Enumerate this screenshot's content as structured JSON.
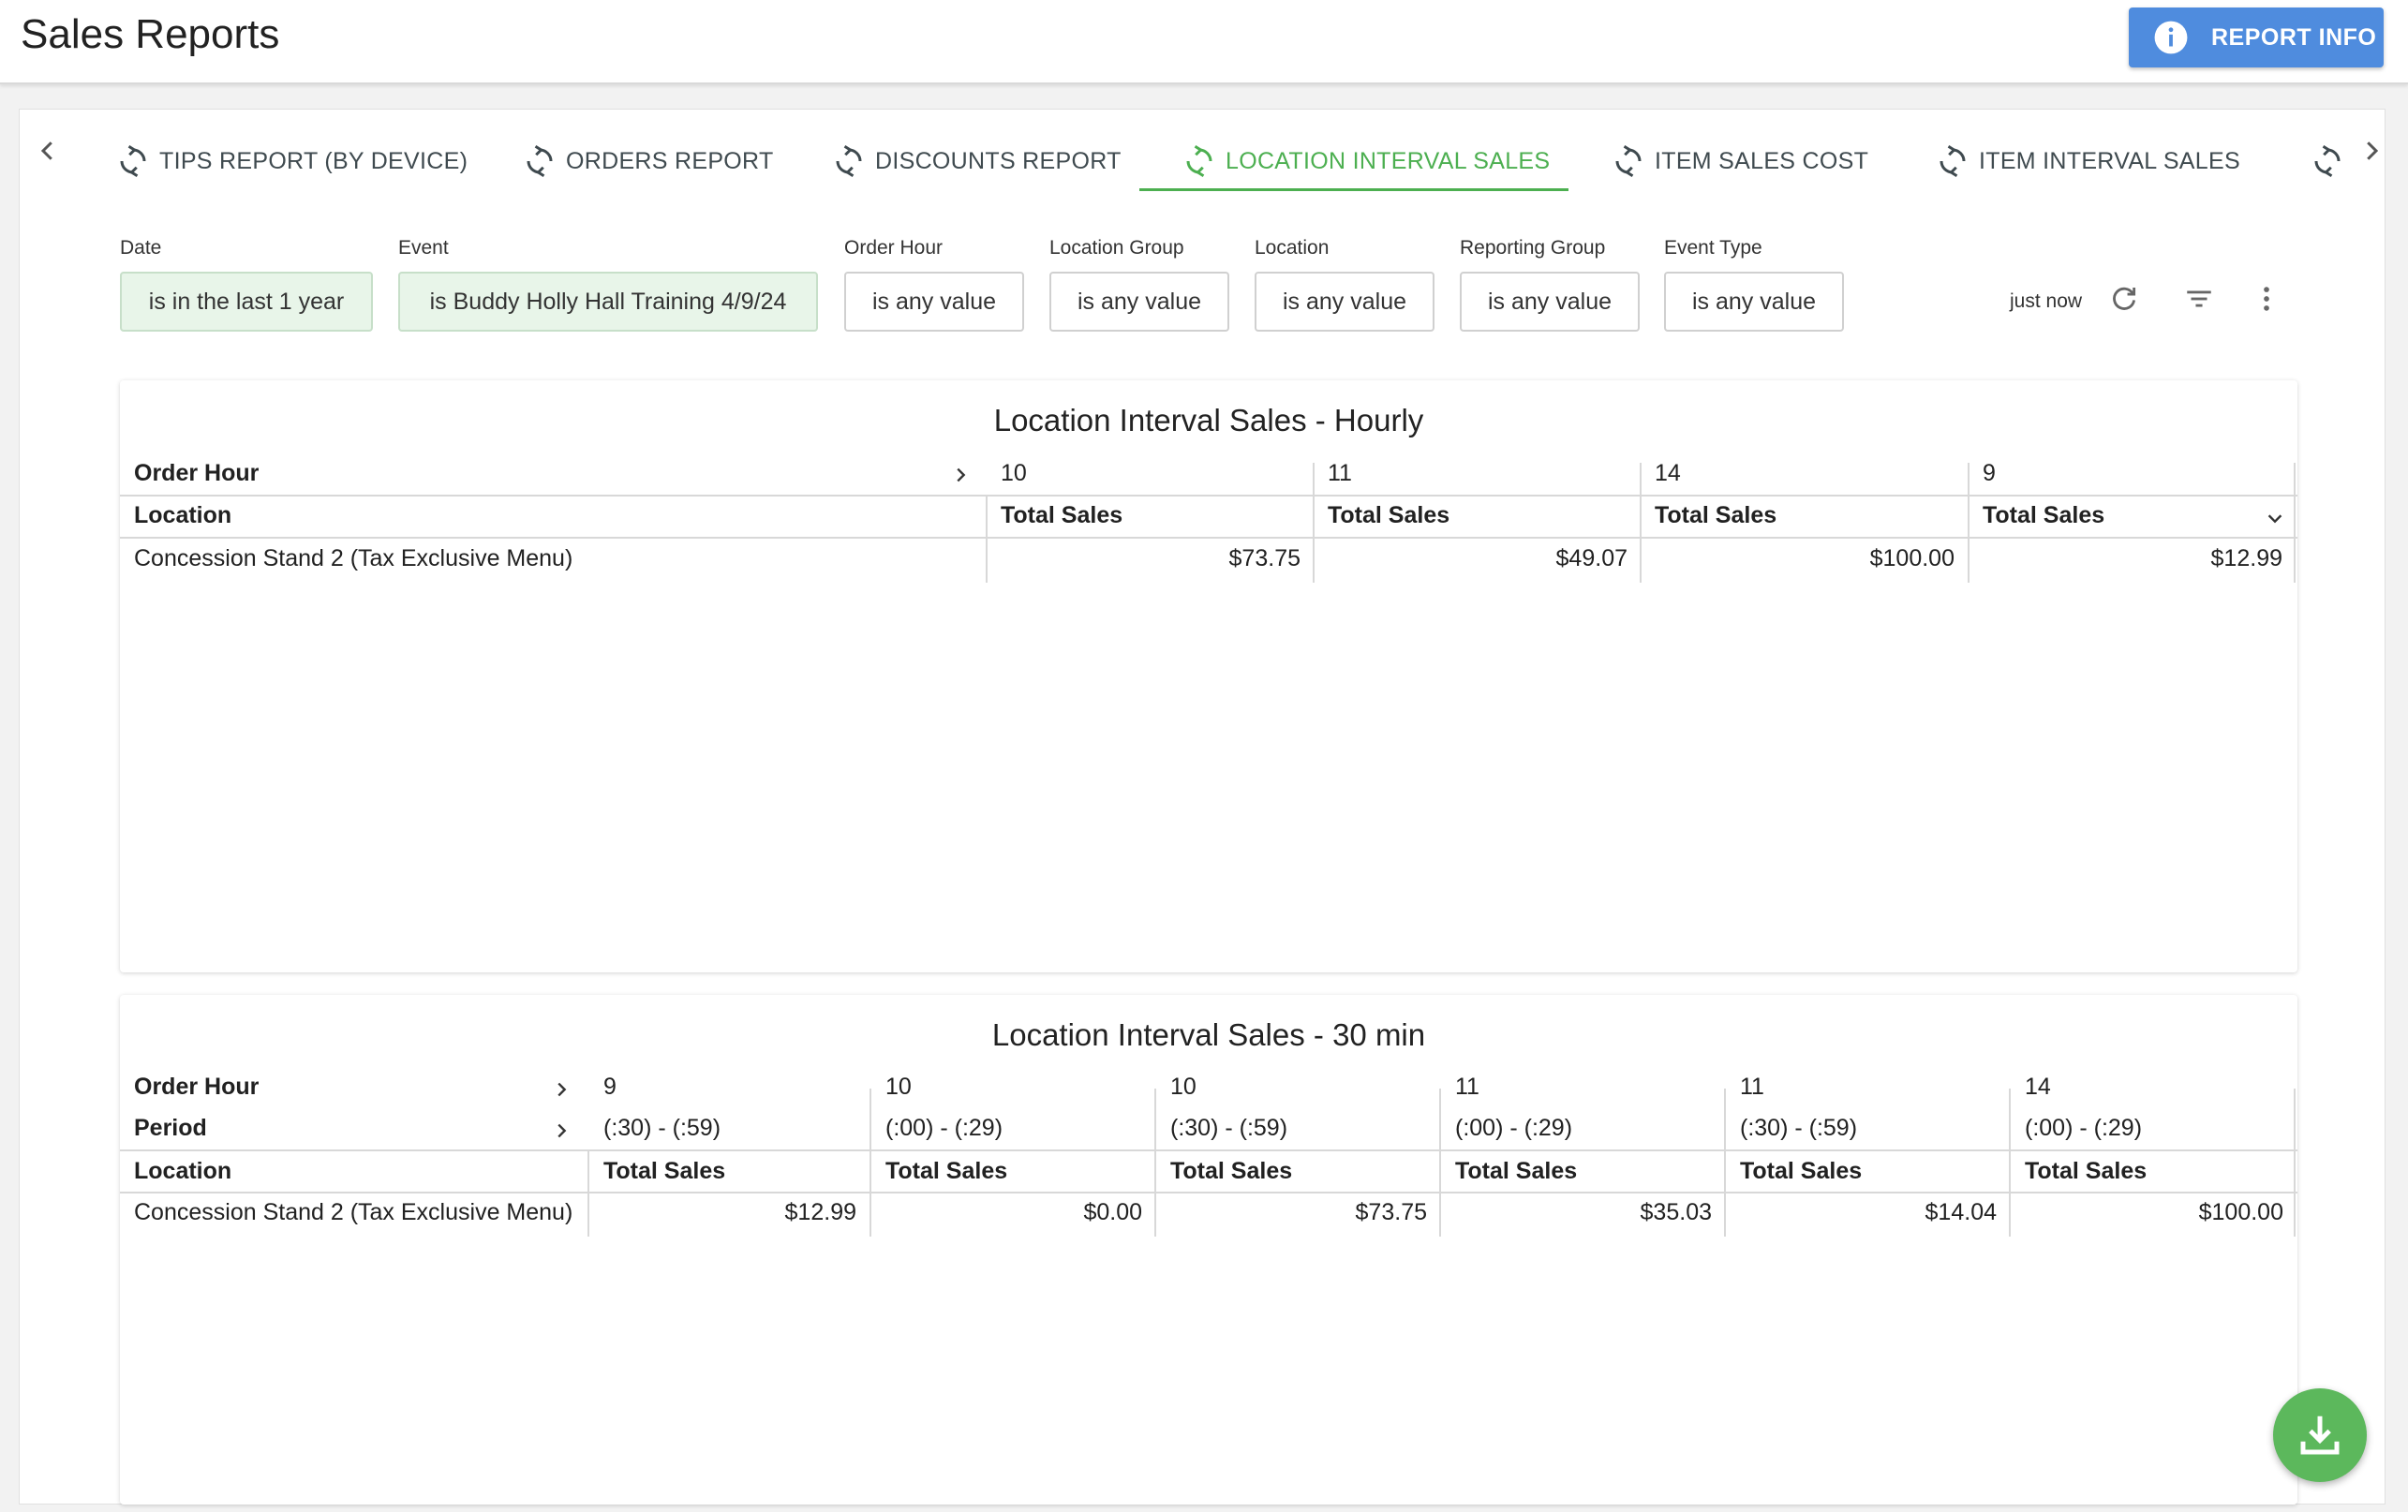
{
  "header": {
    "title": "Sales Reports",
    "report_info_label": "REPORT INFO"
  },
  "tabs": [
    {
      "label": "TIPS REPORT (BY DEVICE)",
      "icon": "refresh-icon"
    },
    {
      "label": "ORDERS REPORT",
      "icon": "refresh-icon"
    },
    {
      "label": "DISCOUNTS REPORT",
      "icon": "refresh-icon"
    },
    {
      "label": "LOCATION INTERVAL SALES",
      "icon": "refresh-icon",
      "active": true
    },
    {
      "label": "ITEM SALES COST",
      "icon": "refresh-icon"
    },
    {
      "label": "ITEM INTERVAL SALES",
      "icon": "refresh-icon"
    }
  ],
  "filters": [
    {
      "label": "Date",
      "value": "is in the last 1 year",
      "active": true
    },
    {
      "label": "Event",
      "value": "is Buddy Holly Hall Training 4/9/24",
      "active": true
    },
    {
      "label": "Order Hour",
      "value": "is any value"
    },
    {
      "label": "Location Group",
      "value": "is any value"
    },
    {
      "label": "Location",
      "value": "is any value"
    },
    {
      "label": "Reporting Group",
      "value": "is any value"
    },
    {
      "label": "Event Type",
      "value": "is any value"
    }
  ],
  "status": {
    "updated": "just now"
  },
  "hourly": {
    "title": "Location Interval Sales - Hourly",
    "pivot_label": "Order Hour",
    "row_label": "Location",
    "measure": "Total Sales",
    "hours": [
      "10",
      "11",
      "14",
      "9"
    ],
    "rows": [
      {
        "location": "Concession Stand 2 (Tax Exclusive Menu)",
        "values": [
          "$73.75",
          "$49.07",
          "$100.00",
          "$12.99"
        ]
      }
    ]
  },
  "half_hour": {
    "title": "Location Interval Sales - 30 min",
    "pivot_label": "Order Hour",
    "period_label": "Period",
    "row_label": "Location",
    "measure": "Total Sales",
    "hours": [
      "9",
      "10",
      "10",
      "11",
      "11",
      "14"
    ],
    "periods": [
      "(:30) - (:59)",
      "(:00) - (:29)",
      "(:30) - (:59)",
      "(:00) - (:29)",
      "(:30) - (:59)",
      "(:00) - (:29)"
    ],
    "rows": [
      {
        "location": "Concession Stand 2 (Tax Exclusive Menu)",
        "values": [
          "$12.99",
          "$0.00",
          "$73.75",
          "$35.03",
          "$14.04",
          "$100.00"
        ]
      }
    ]
  },
  "colors": {
    "accent": "#4caf50",
    "brand_button": "#4f8cde",
    "fab": "#5cb85c"
  }
}
